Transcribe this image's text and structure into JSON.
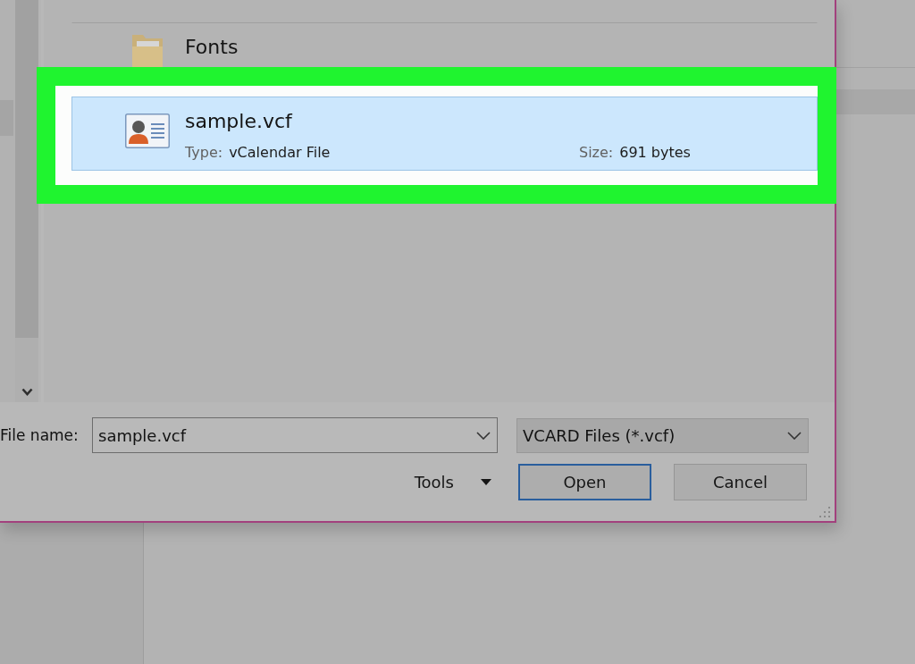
{
  "dialog": {
    "navigation_pane": {
      "items": [
        {
          "selected": true
        }
      ]
    },
    "files": [
      {
        "kind": "folder",
        "name": "Fonts",
        "selected": false,
        "highlighted": false
      },
      {
        "kind": "contact",
        "name": "sample.vcf",
        "selected": true,
        "highlighted": true,
        "details": [
          {
            "label": "Type:",
            "value": "vCalendar File"
          },
          {
            "label": "Size:",
            "value": "691 bytes"
          }
        ]
      }
    ],
    "file_name": {
      "label": "File name:",
      "value": "sample.vcf"
    },
    "file_type": {
      "value": "VCARD Files (*.vcf)"
    },
    "tools_menu": {
      "label": "Tools"
    },
    "buttons": [
      {
        "label": "Open",
        "default": true
      },
      {
        "label": "Cancel",
        "default": false
      }
    ]
  }
}
